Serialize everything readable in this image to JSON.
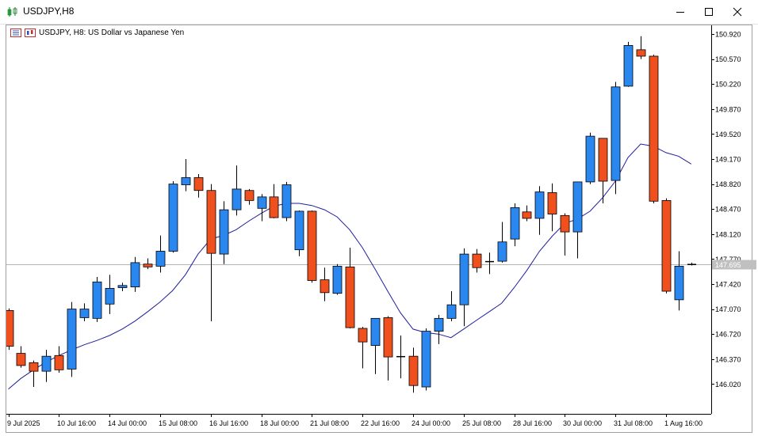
{
  "window": {
    "title": "USDJPY,H8",
    "minimize_icon": "minimize-icon",
    "maximize_icon": "maximize-icon",
    "close_icon": "close-icon"
  },
  "chart_label": "USDJPY, H8:  US Dollar vs Japanese Yen",
  "colors": {
    "bull": "#2b87f0",
    "bear": "#f0501e",
    "wick": "#000000",
    "ma": "#1e1ea0",
    "bidline": "#b4b4b4",
    "bidbox": "#c0c0c0"
  },
  "chart_data": {
    "type": "candlestick",
    "title": "USDJPY, H8:  US Dollar vs Japanese Yen",
    "ylim": [
      145.7,
      150.97
    ],
    "y_ticks": [
      "150.920",
      "150.570",
      "150.220",
      "149.870",
      "149.520",
      "149.170",
      "148.820",
      "148.470",
      "148.120",
      "147.770",
      "147.420",
      "147.070",
      "146.720",
      "146.370",
      "146.020"
    ],
    "x_tick_labels": [
      "9 Jul 2025",
      "10 Jul 16:00",
      "14 Jul 00:00",
      "15 Jul 08:00",
      "16 Jul 16:00",
      "18 Jul 00:00",
      "21 Jul 08:00",
      "22 Jul 16:00",
      "24 Jul 00:00",
      "25 Jul 08:00",
      "28 Jul 16:00",
      "30 Jul 00:00",
      "31 Jul 08:00",
      "1 Aug 16:00"
    ],
    "x_tick_indices": [
      0,
      4,
      8,
      12,
      16,
      20,
      24,
      28,
      32,
      36,
      40,
      44,
      48,
      52
    ],
    "bid": "147.695",
    "candles": [
      {
        "o": 147.05,
        "h": 147.08,
        "l": 146.5,
        "c": 146.55
      },
      {
        "o": 146.45,
        "h": 146.55,
        "l": 146.25,
        "c": 146.28
      },
      {
        "o": 146.32,
        "h": 146.35,
        "l": 145.98,
        "c": 146.2
      },
      {
        "o": 146.2,
        "h": 146.5,
        "l": 146.05,
        "c": 146.41
      },
      {
        "o": 146.42,
        "h": 146.55,
        "l": 146.18,
        "c": 146.22
      },
      {
        "o": 146.23,
        "h": 147.17,
        "l": 146.12,
        "c": 147.07
      },
      {
        "o": 146.95,
        "h": 147.15,
        "l": 146.9,
        "c": 147.07
      },
      {
        "o": 146.94,
        "h": 147.52,
        "l": 146.89,
        "c": 147.45
      },
      {
        "o": 147.14,
        "h": 147.55,
        "l": 147.0,
        "c": 147.36
      },
      {
        "o": 147.37,
        "h": 147.44,
        "l": 147.32,
        "c": 147.4
      },
      {
        "o": 147.38,
        "h": 147.8,
        "l": 147.31,
        "c": 147.72
      },
      {
        "o": 147.7,
        "h": 147.78,
        "l": 147.63,
        "c": 147.66
      },
      {
        "o": 147.67,
        "h": 148.1,
        "l": 147.58,
        "c": 147.88
      },
      {
        "o": 147.88,
        "h": 148.86,
        "l": 147.86,
        "c": 148.82
      },
      {
        "o": 148.81,
        "h": 149.17,
        "l": 148.72,
        "c": 148.91
      },
      {
        "o": 148.91,
        "h": 148.96,
        "l": 148.63,
        "c": 148.73
      },
      {
        "o": 148.73,
        "h": 148.82,
        "l": 146.9,
        "c": 147.85
      },
      {
        "o": 147.84,
        "h": 148.58,
        "l": 147.7,
        "c": 148.46
      },
      {
        "o": 148.46,
        "h": 149.08,
        "l": 148.38,
        "c": 148.75
      },
      {
        "o": 148.73,
        "h": 148.75,
        "l": 148.53,
        "c": 148.59
      },
      {
        "o": 148.48,
        "h": 148.68,
        "l": 148.3,
        "c": 148.64
      },
      {
        "o": 148.64,
        "h": 148.82,
        "l": 148.34,
        "c": 148.35
      },
      {
        "o": 148.35,
        "h": 148.85,
        "l": 148.3,
        "c": 148.81
      },
      {
        "o": 147.9,
        "h": 148.45,
        "l": 147.81,
        "c": 148.44
      },
      {
        "o": 148.44,
        "h": 148.45,
        "l": 147.44,
        "c": 147.47
      },
      {
        "o": 147.48,
        "h": 147.65,
        "l": 147.18,
        "c": 147.3
      },
      {
        "o": 147.29,
        "h": 147.7,
        "l": 147.27,
        "c": 147.67
      },
      {
        "o": 147.66,
        "h": 147.93,
        "l": 146.8,
        "c": 146.81
      },
      {
        "o": 146.8,
        "h": 146.82,
        "l": 146.24,
        "c": 146.61
      },
      {
        "o": 146.56,
        "h": 146.94,
        "l": 146.16,
        "c": 146.94
      },
      {
        "o": 146.95,
        "h": 146.97,
        "l": 146.07,
        "c": 146.4
      },
      {
        "o": 146.4,
        "h": 146.7,
        "l": 146.1,
        "c": 146.41
      },
      {
        "o": 146.41,
        "h": 146.53,
        "l": 145.9,
        "c": 146.0
      },
      {
        "o": 145.98,
        "h": 146.8,
        "l": 145.93,
        "c": 146.76
      },
      {
        "o": 146.76,
        "h": 146.99,
        "l": 146.58,
        "c": 146.94
      },
      {
        "o": 146.94,
        "h": 147.32,
        "l": 146.9,
        "c": 147.13
      },
      {
        "o": 147.13,
        "h": 147.92,
        "l": 146.83,
        "c": 147.84
      },
      {
        "o": 147.84,
        "h": 147.91,
        "l": 147.58,
        "c": 147.65
      },
      {
        "o": 147.73,
        "h": 147.86,
        "l": 147.56,
        "c": 147.74
      },
      {
        "o": 147.74,
        "h": 148.29,
        "l": 147.72,
        "c": 148.01
      },
      {
        "o": 148.05,
        "h": 148.55,
        "l": 147.95,
        "c": 148.49
      },
      {
        "o": 148.43,
        "h": 148.52,
        "l": 148.3,
        "c": 148.34
      },
      {
        "o": 148.34,
        "h": 148.79,
        "l": 148.11,
        "c": 148.71
      },
      {
        "o": 148.7,
        "h": 148.83,
        "l": 148.16,
        "c": 148.4
      },
      {
        "o": 148.38,
        "h": 148.41,
        "l": 147.82,
        "c": 148.15
      },
      {
        "o": 148.15,
        "h": 148.84,
        "l": 147.78,
        "c": 148.85
      },
      {
        "o": 148.85,
        "h": 149.54,
        "l": 148.82,
        "c": 149.49
      },
      {
        "o": 149.46,
        "h": 149.46,
        "l": 148.55,
        "c": 148.86
      },
      {
        "o": 148.87,
        "h": 150.25,
        "l": 148.68,
        "c": 150.18
      },
      {
        "o": 150.19,
        "h": 150.81,
        "l": 150.18,
        "c": 150.76
      },
      {
        "o": 150.7,
        "h": 150.89,
        "l": 150.57,
        "c": 150.61
      },
      {
        "o": 150.61,
        "h": 150.63,
        "l": 148.55,
        "c": 148.58
      },
      {
        "o": 148.59,
        "h": 148.62,
        "l": 147.29,
        "c": 147.32
      },
      {
        "o": 147.2,
        "h": 147.88,
        "l": 147.05,
        "c": 147.67
      },
      {
        "o": 147.7,
        "h": 147.72,
        "l": 147.68,
        "c": 147.69
      }
    ],
    "ma": [
      145.95,
      146.1,
      146.22,
      146.33,
      146.42,
      146.5,
      146.57,
      146.63,
      146.7,
      146.79,
      146.9,
      147.03,
      147.17,
      147.33,
      147.55,
      147.84,
      148.05,
      148.1,
      148.18,
      148.3,
      148.41,
      148.51,
      148.55,
      148.55,
      148.52,
      148.46,
      148.36,
      148.18,
      147.93,
      147.63,
      147.32,
      147.02,
      146.79,
      146.74,
      146.72,
      146.67,
      146.79,
      146.91,
      147.03,
      147.15,
      147.37,
      147.61,
      147.88,
      148.09,
      148.27,
      148.33,
      148.44,
      148.63,
      148.86,
      149.19,
      149.38,
      149.35,
      149.26,
      149.21,
      149.1
    ]
  }
}
